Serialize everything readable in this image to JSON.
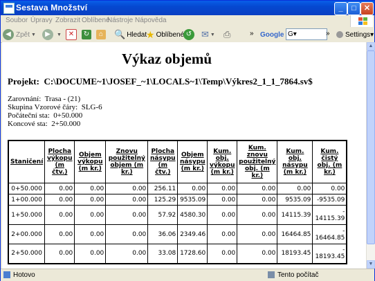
{
  "window": {
    "title": "Sestava Množství"
  },
  "menu": [
    "Soubor",
    "Úpravy",
    "Zobrazit",
    "Oblíbené",
    "Nástroje",
    "Nápověda"
  ],
  "toolbar": {
    "back": "Zpět",
    "search": "Hledat",
    "favorites": "Oblíbené",
    "google": "Google",
    "google_input": "G▾",
    "settings": "Settings▾",
    "more": "»"
  },
  "report": {
    "title": "Výkaz objemů",
    "project_label": "Projekt:",
    "project_path": "C:\\DOCUME~1\\JOSEF_~1\\LOCALS~1\\Temp\\Výkres2_1_1_7864.sv$",
    "info": [
      {
        "label": "Zarovnání:",
        "value": "Trasa - (21)"
      },
      {
        "label": "Skupina Vzorové čáry:",
        "value": "SLG-6"
      },
      {
        "label": "Počáteční sta:",
        "value": "0+50.000"
      },
      {
        "label": "Koncové sta:",
        "value": "2+50.000"
      }
    ]
  },
  "table": {
    "headers": [
      [
        "Staničení"
      ],
      [
        "Plocha",
        "výkopu",
        "(m",
        "čtv.)"
      ],
      [
        "Objem",
        "výkopu",
        "(m kr.)"
      ],
      [
        "Znovu",
        "použitelný",
        "objem (m",
        "kr.)"
      ],
      [
        "Plocha",
        "násypu",
        "(m",
        "čtv.)"
      ],
      [
        "Objem",
        "násypu",
        "(m kr.)"
      ],
      [
        "Kum.",
        "obj.",
        "výkopu",
        "(m kr.)"
      ],
      [
        "Kum.",
        "znovu",
        "použitelný",
        "obj. (m",
        "kr.)"
      ],
      [
        "Kum.",
        "obj.",
        "násypu",
        "(m kr.)"
      ],
      [
        "Kum.",
        "čistý",
        "obj. (m",
        "kr.)"
      ]
    ],
    "rows": [
      [
        "0+50.000",
        "0.00",
        "0.00",
        "0.00",
        "256.11",
        "0.00",
        "0.00",
        "0.00",
        "0.00",
        "0.00"
      ],
      [
        "1+00.000",
        "0.00",
        "0.00",
        "0.00",
        "125.29",
        "9535.09",
        "0.00",
        "0.00",
        "9535.09",
        "-9535.09"
      ],
      [
        "1+50.000",
        "0.00",
        "0.00",
        "0.00",
        "57.92",
        "4580.30",
        "0.00",
        "0.00",
        "14115.39",
        "-\n14115.39"
      ],
      [
        "2+00.000",
        "0.00",
        "0.00",
        "0.00",
        "36.06",
        "2349.46",
        "0.00",
        "0.00",
        "16464.85",
        "-\n16464.85"
      ],
      [
        "2+50.000",
        "0.00",
        "0.00",
        "0.00",
        "33.08",
        "1728.60",
        "0.00",
        "0.00",
        "18193.45",
        "-\n18193.45"
      ]
    ]
  },
  "status": {
    "left": "Hotovo",
    "zone": "Tento počítač"
  }
}
